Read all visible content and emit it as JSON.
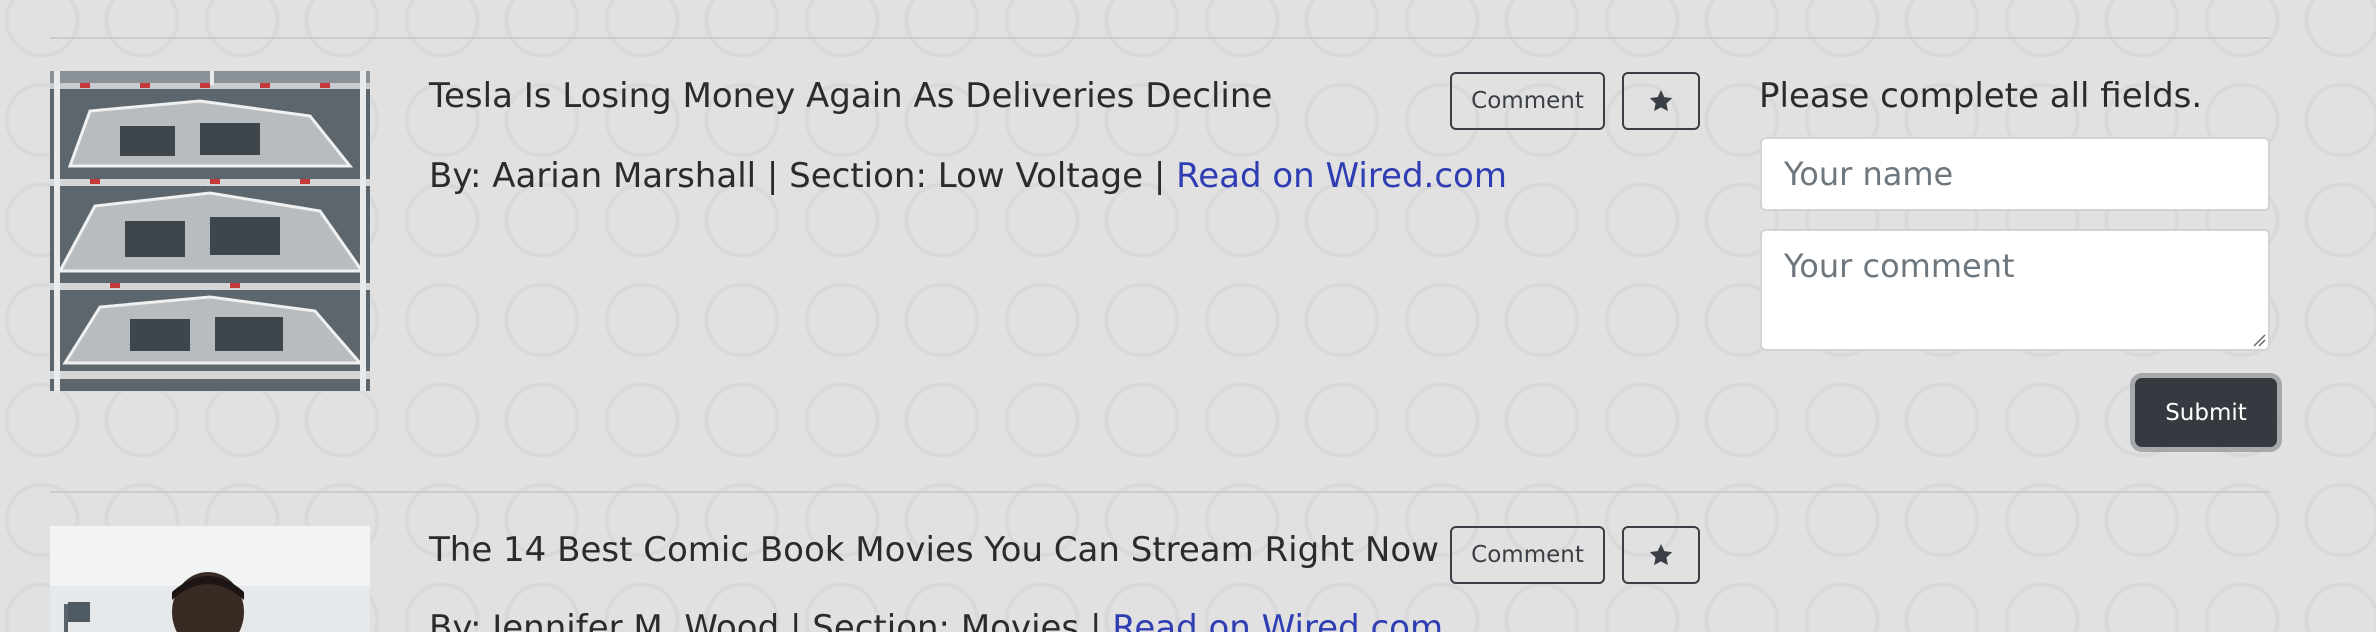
{
  "articles": [
    {
      "title": "Tesla Is Losing Money Again As Deliveries Decline",
      "by_prefix": "By: Aarian Marshall | Section: Low Voltage | ",
      "link_text": "Read on Wired.com",
      "comment_label": "Comment"
    },
    {
      "title": "The 14 Best Comic Book Movies You Can Stream Right Now",
      "by_prefix": "By: Jennifer M. Wood | Section: Movies | ",
      "link_text": "Read on Wired.com",
      "comment_label": "Comment"
    }
  ],
  "comment_form": {
    "message": "Please complete all fields.",
    "name_placeholder": "Your name",
    "comment_placeholder": "Your comment",
    "submit_label": "Submit"
  },
  "colors": {
    "link": "#2f3db3",
    "submit_bg": "#343a40",
    "page_bg": "#e1e1e1"
  },
  "icons": {
    "favorite": "star-icon"
  }
}
